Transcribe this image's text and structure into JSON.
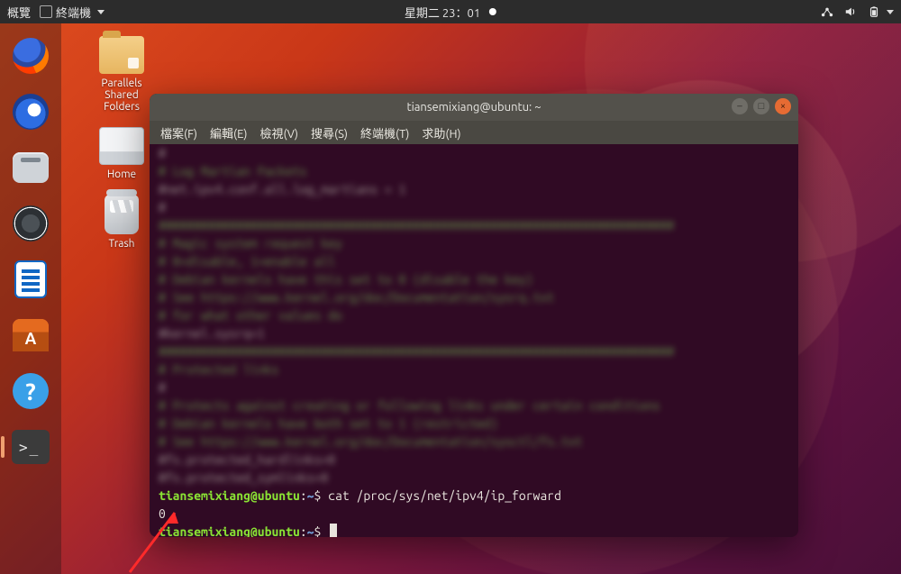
{
  "topbar": {
    "activities": "概覽",
    "app_name": "終端機",
    "clock": "星期二 23：01",
    "icons": {
      "network": "network-icon",
      "volume": "volume-icon",
      "battery": "battery-icon"
    }
  },
  "dock": {
    "apps": [
      {
        "name": "firefox"
      },
      {
        "name": "thunderbird"
      },
      {
        "name": "files"
      },
      {
        "name": "rhythmbox"
      },
      {
        "name": "libreoffice-writer"
      },
      {
        "name": "ubuntu-software"
      },
      {
        "name": "help"
      },
      {
        "name": "terminal",
        "active": true
      }
    ]
  },
  "desktop": {
    "icons": [
      {
        "id": "parallels",
        "label": "Parallels\nShared\nFolders"
      },
      {
        "id": "home",
        "label": "Home"
      },
      {
        "id": "trash",
        "label": "Trash"
      }
    ]
  },
  "terminal": {
    "title": "tiansemixiang@ubuntu: ~",
    "menus": [
      "檔案(F)",
      "編輯(E)",
      "檢視(V)",
      "搜尋(S)",
      "終端機(T)",
      "求助(H)"
    ],
    "window_buttons": {
      "min": "–",
      "max": "□",
      "close": "×"
    },
    "blurred_lines": [
      "#",
      "# Log Martian Packets",
      "#net.ipv4.conf.all.log_martians = 1",
      "#",
      "",
      "#########################################################################",
      "# Magic system request key",
      "# 0=disable, 1=enable all",
      "# Debian kernels have this set to 0 (disable the key)",
      "# See https://www.kernel.org/doc/Documentation/sysrq.txt",
      "# for what other values do",
      "#kernel.sysrq=1",
      "",
      "#########################################################################",
      "# Protected links",
      "#",
      "# Protects against creating or following links under certain conditions",
      "# Debian kernels have both set to 1 (restricted)",
      "# See https://www.kernel.org/doc/Documentation/sysctl/fs.txt",
      "#fs.protected_hardlinks=0",
      "#fs.protected_symlinks=0"
    ],
    "prompt": {
      "user": "tiansemixiang@ubuntu",
      "sep": ":",
      "path": "~",
      "dollar": "$"
    },
    "command": "cat  /proc/sys/net/ipv4/ip_forward",
    "output": "0"
  }
}
